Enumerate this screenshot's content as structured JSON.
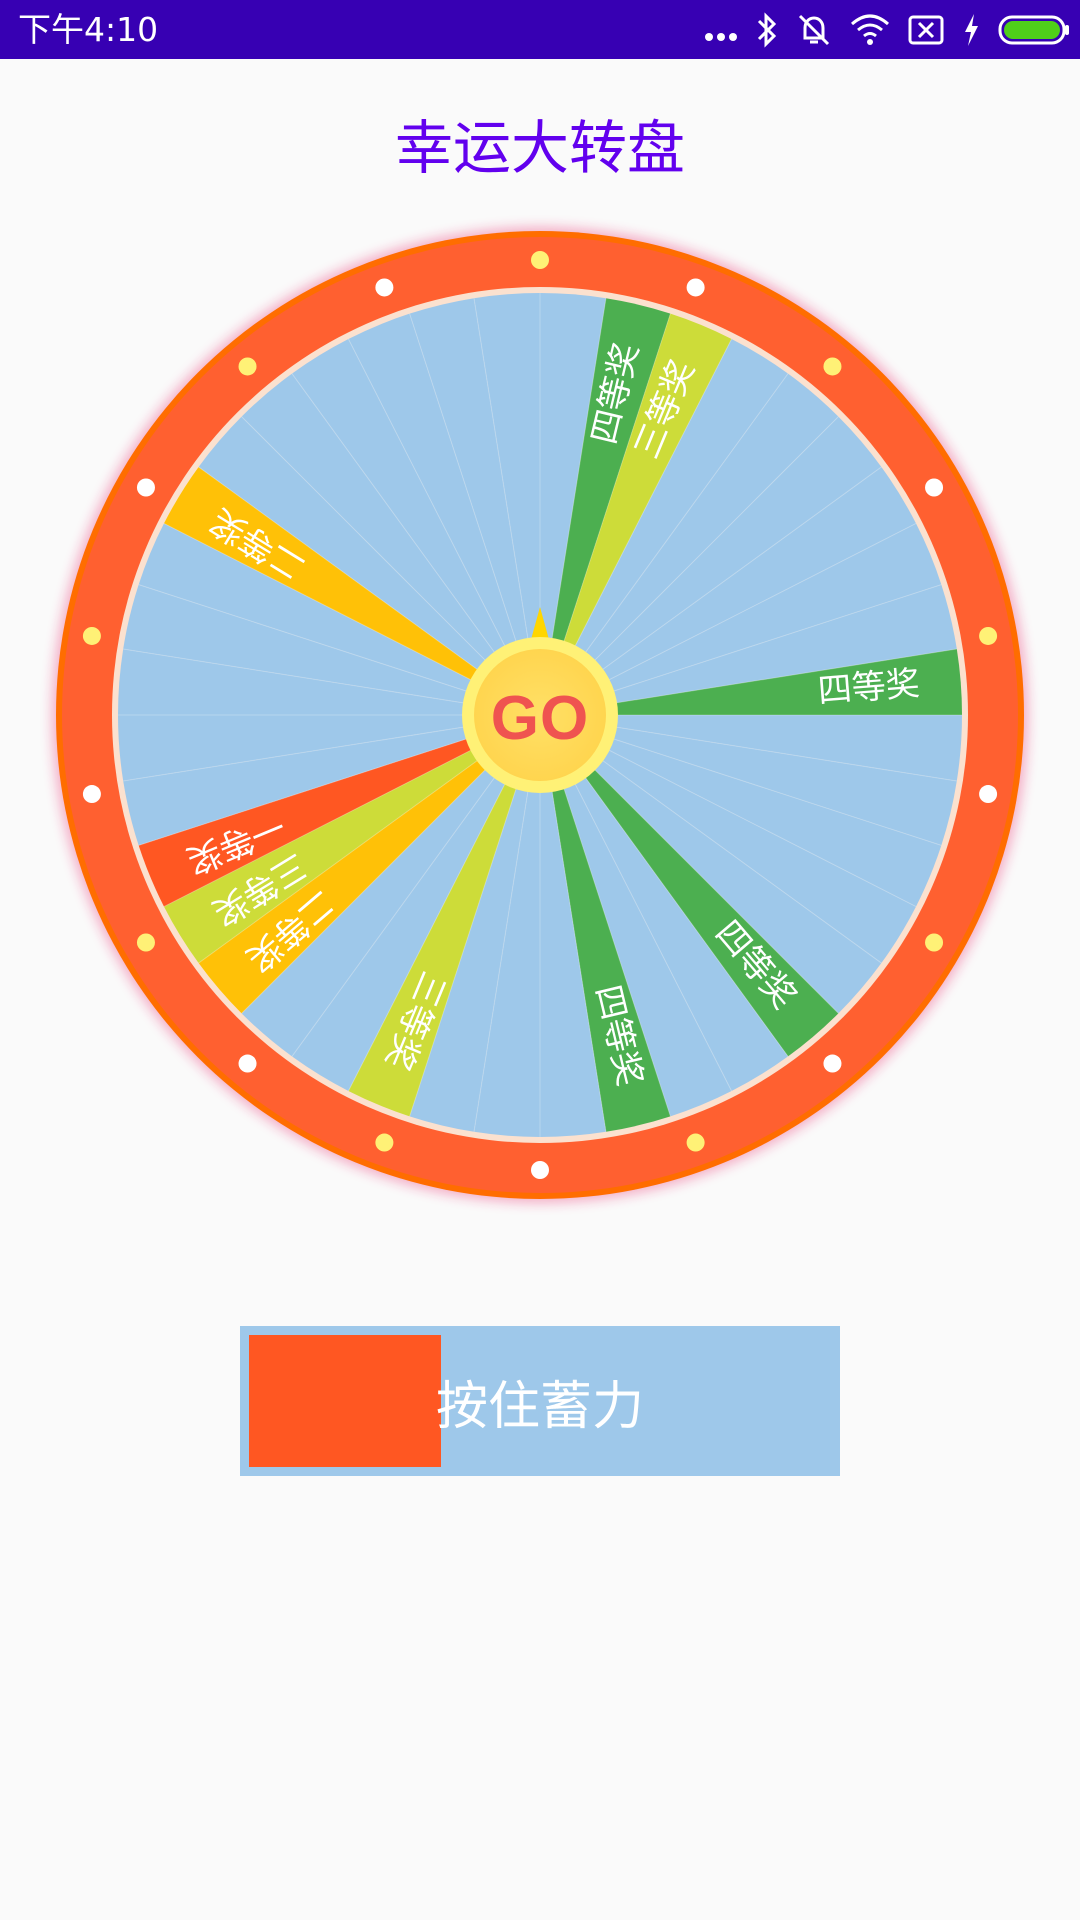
{
  "status_bar": {
    "time": "下午4:10",
    "background": "#3700b3",
    "icons": [
      "more-dots-icon",
      "bluetooth-icon",
      "do-not-disturb-icon",
      "wifi-icon",
      "no-sim-icon",
      "charging-icon",
      "battery-icon"
    ]
  },
  "title": "幸运大转盘",
  "title_color": "#6200ee",
  "wheel": {
    "go_label": "GO",
    "ring_color": "#ff6030",
    "empty_color": "#9ec8ea",
    "prizes": [
      {
        "label": "四等奖",
        "color": "#4caf50"
      },
      {
        "label": "三等奖",
        "color": "#cddc39"
      },
      {
        "label": "四等奖",
        "color": "#4caf50"
      },
      {
        "label": "四等奖",
        "color": "#4caf50"
      },
      {
        "label": "四等奖",
        "color": "#4caf50"
      },
      {
        "label": "三等奖",
        "color": "#cddc39"
      },
      {
        "label": "二等奖",
        "color": "#ffc107"
      },
      {
        "label": "三等奖",
        "color": "#cddc39"
      },
      {
        "label": "一等奖",
        "color": "#ff5722"
      },
      {
        "label": "二等奖",
        "color": "#ffc107"
      }
    ]
  },
  "power_button": {
    "label": "按住蓄力",
    "charge_fraction": 0.33,
    "track_color": "#9ec8ea",
    "fill_color": "#ff5722"
  }
}
